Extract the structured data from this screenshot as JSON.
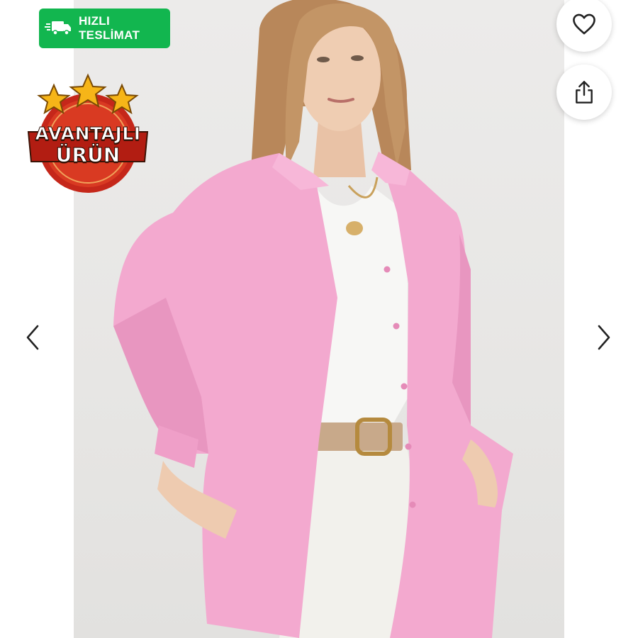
{
  "badges": {
    "fast_delivery": {
      "line1": "HIZLI",
      "line2": "TESLİMAT",
      "color": "#12b64f",
      "icon": "delivery-truck-icon"
    },
    "advantage": {
      "line1": "AVANTAJLI",
      "line2": "ÜRÜN",
      "star_count": 3,
      "colors": {
        "ring": "#c5271a",
        "star": "#f6b518"
      }
    }
  },
  "actions": {
    "favorite": {
      "icon": "heart-icon"
    },
    "share": {
      "icon": "share-icon"
    }
  },
  "navigation": {
    "prev": {
      "icon": "chevron-left-icon"
    },
    "next": {
      "icon": "chevron-right-icon"
    }
  },
  "product_image": {
    "subject": "pink oversized shirt over white t-shirt with beige belt",
    "colors": {
      "shirt": "#f3a9cf",
      "background": "#e9e8e6"
    }
  }
}
